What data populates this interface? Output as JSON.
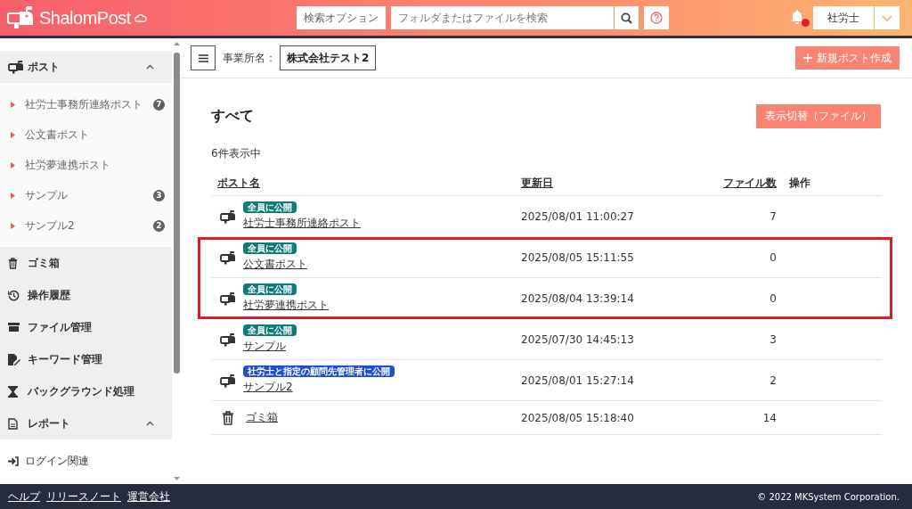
{
  "header": {
    "logo": "ShalomPost",
    "search_options_button": "検索オプション",
    "search": {
      "placeholder": "フォルダまたはファイルを検索"
    },
    "notification": {
      "unread": true
    },
    "user": "社労士"
  },
  "sidebar": {
    "items": [
      {
        "label": "ポスト",
        "expanded": true,
        "children": [
          {
            "kind": "post",
            "label": "社労士事務所連絡ポスト",
            "count": "7"
          },
          {
            "kind": "post",
            "label": "公文書ポスト"
          },
          {
            "kind": "post",
            "label": "社労夢連携ポスト"
          },
          {
            "kind": "post",
            "label": "サンプル",
            "count": "3"
          },
          {
            "kind": "post",
            "label": "サンプル2",
            "count": "2"
          }
        ]
      },
      {
        "label": "ゴミ箱"
      },
      {
        "label": "操作履歴"
      },
      {
        "label": "ファイル管理"
      },
      {
        "label": "キーワード管理"
      },
      {
        "label": "バックグラウンド処理"
      },
      {
        "label": "レポート",
        "expanded": true,
        "children": [
          {
            "kind": "link",
            "label": "ログイン関連"
          }
        ]
      }
    ]
  },
  "toolbar": {
    "office_label": "事業所名：",
    "office_name": "株式会社テスト2",
    "new_button": "新規ポスト作成"
  },
  "page": {
    "title": "すべて",
    "view_toggle": "表示切替（ファイル）",
    "result_count": "6件表示中"
  },
  "table": {
    "columns": [
      {
        "label": "ポスト名",
        "sortable": true
      },
      {
        "label": "更新日",
        "sortable": true
      },
      {
        "label": "ファイル数",
        "sortable": true
      },
      {
        "label": "操作",
        "sortable": false
      }
    ],
    "rows": [
      {
        "kind": "post",
        "badge": "全員に公開",
        "color": "#0f7b7b",
        "name": "社労士事務所連絡ポスト",
        "updated": "2025/08/01 11:00:27",
        "files": "7",
        "highlighted": false
      },
      {
        "kind": "post",
        "badge": "全員に公開",
        "color": "#0f7b7b",
        "name": "公文書ポスト",
        "updated": "2025/08/05 15:11:55",
        "files": "0",
        "highlighted": true
      },
      {
        "kind": "post",
        "badge": "全員に公開",
        "color": "#0f7b7b",
        "name": "社労夢連携ポスト",
        "updated": "2025/08/04 13:39:14",
        "files": "0",
        "highlighted": true
      },
      {
        "kind": "post",
        "badge": "全員に公開",
        "color": "#0f7b7b",
        "name": "サンプル",
        "updated": "2025/07/30 14:45:13",
        "files": "3",
        "highlighted": false
      },
      {
        "kind": "post",
        "badge": "社労士と指定の顧問先管理者に公開",
        "color": "#1d4fd6",
        "name": "サンプル2",
        "updated": "2025/08/01 15:27:14",
        "files": "2",
        "highlighted": false
      },
      {
        "kind": "trash",
        "name": "ゴミ箱",
        "updated": "2025/08/05 15:18:40",
        "files": "14",
        "highlighted": false
      }
    ]
  },
  "footer": {
    "links": [
      "ヘルプ",
      "リリースノート",
      "運営会社"
    ],
    "copyright": "© 2022 MKSystem Corporation."
  }
}
